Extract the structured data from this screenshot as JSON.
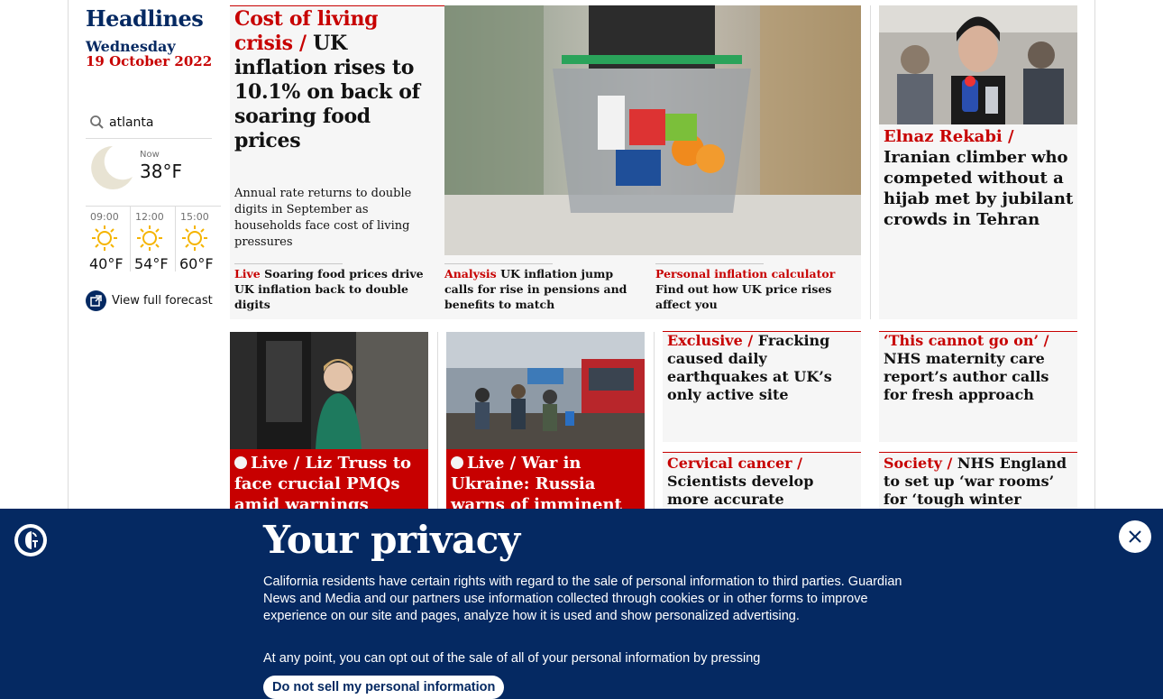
{
  "left": {
    "title": "Headlines",
    "day": "Wednesday",
    "date": "19 October 2022"
  },
  "weather": {
    "location": "atlanta",
    "now_label": "Now",
    "now_temp": "38°F",
    "forecast": [
      {
        "time": "09:00",
        "temp": "40°F"
      },
      {
        "time": "12:00",
        "temp": "54°F"
      },
      {
        "time": "15:00",
        "temp": "60°F"
      }
    ],
    "full_forecast": "View full forecast"
  },
  "lead": {
    "kicker": "Cost of living crisis",
    "separator": " / ",
    "headline": "UK inflation rises to 10.1% on back of soaring food prices",
    "standfirst": "Annual rate returns to double digits in September as households face cost of living pressures",
    "sublinks": [
      {
        "kicker": "Live",
        "text": "Soaring food prices drive UK inflation back to double digits"
      },
      {
        "kicker": "Analysis",
        "text": "UK inflation jump calls for rise in pensions and benefits to match"
      },
      {
        "kicker": "Personal inflation calculator",
        "text": "Find out how UK price rises affect you"
      }
    ]
  },
  "right_card": {
    "kicker": "Elnaz Rekabi /",
    "headline": "Iranian climber who competed without a hijab met by jubilant crowds in Tehran"
  },
  "row2": [
    {
      "kicker": "Live /",
      "headline": "Liz Truss to face crucial PMQs amid warnings"
    },
    {
      "kicker": "Live /",
      "headline": "War in Ukraine: Russia warns of imminent fight for"
    },
    {
      "kicker": "Exclusive /",
      "headline": "Fracking caused daily earthquakes at UK’s only active site"
    },
    {
      "kicker": "‘This cannot go on’ /",
      "headline": "NHS maternity care report’s author calls for fresh approach"
    },
    {
      "kicker": "Cervical cancer /",
      "headline": "Scientists develop more accurate predictive test"
    },
    {
      "kicker": "Society /",
      "headline": "NHS England to set up ‘war rooms’ for ‘tough winter ahead’"
    }
  ],
  "privacy": {
    "title": "Your privacy",
    "body": "California residents have certain rights with regard to the sale of personal information to third parties. Guardian News and Media and our partners use information collected through cookies or in other forms to improve experience on our site and pages, analyze how it is used and show personalized advertising.",
    "body2": "At any point, you can opt out of the sale of all of your personal information by pressing",
    "button": "Do not sell my personal information"
  },
  "colors": {
    "brand": "#052962",
    "news_red": "#c70000"
  }
}
